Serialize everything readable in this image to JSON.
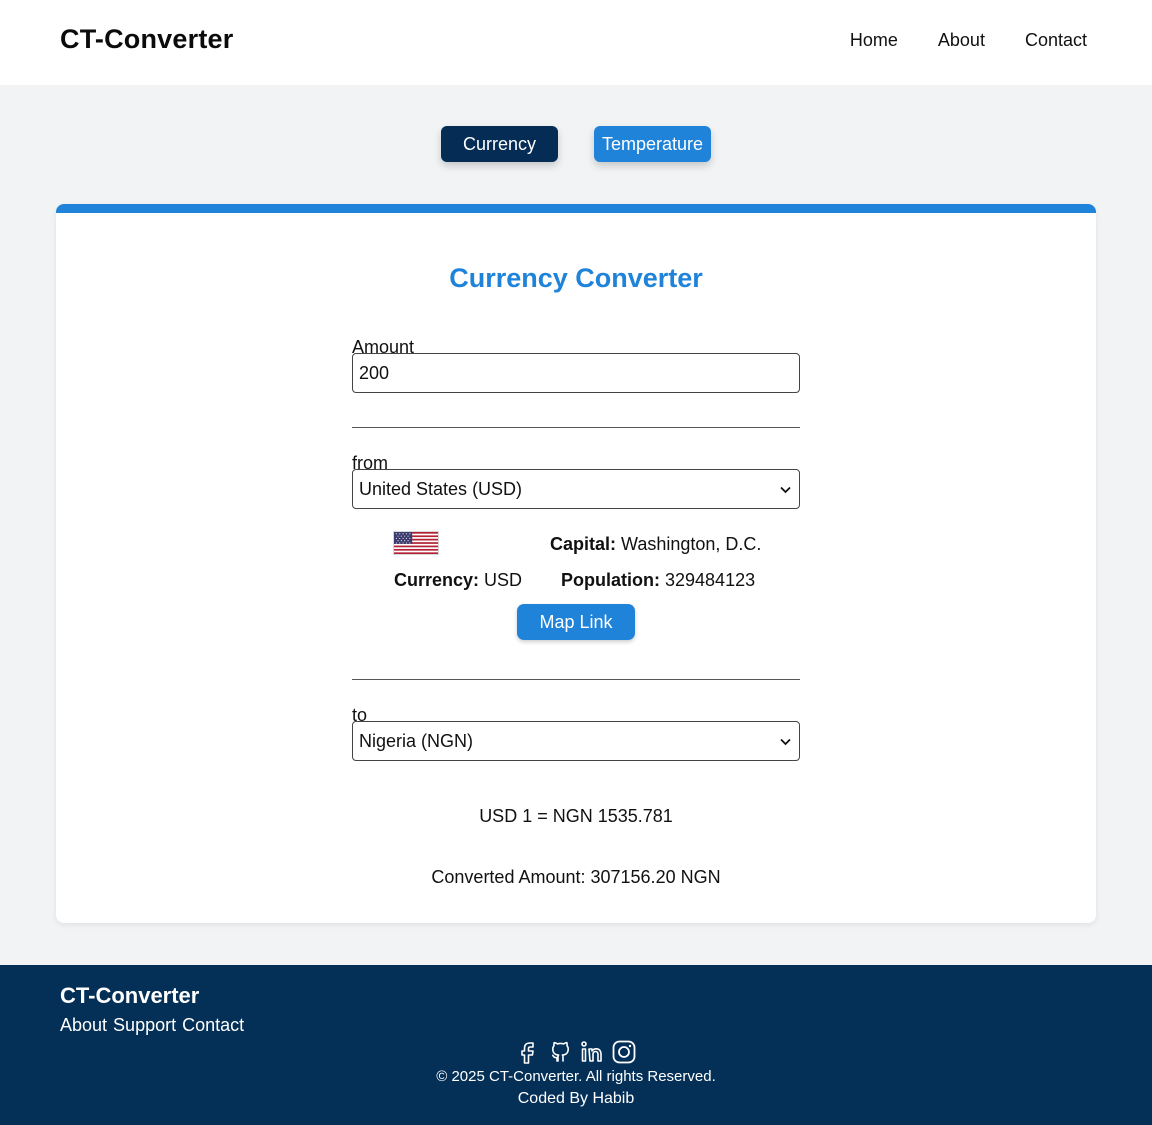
{
  "header": {
    "brand": "CT-Converter",
    "nav": [
      "Home",
      "About",
      "Contact"
    ]
  },
  "tabs": {
    "currency": "Currency",
    "temperature": "Temperature"
  },
  "converter": {
    "title": "Currency Converter",
    "amount_label": "Amount",
    "amount_value": "200",
    "from_label": "from",
    "from_value": "United States (USD)",
    "to_label": "to",
    "to_value": "Nigeria (NGN)",
    "country_info": {
      "capital_label": "Capital:",
      "capital_value": "Washington, D.C.",
      "currency_label": "Currency:",
      "currency_value": "USD",
      "population_label": "Population:",
      "population_value": "329484123",
      "map_link": "Map Link"
    },
    "rate_text": "USD 1 = NGN 1535.781",
    "converted_text": "Converted Amount: 307156.20 NGN"
  },
  "footer": {
    "brand": "CT-Converter",
    "links": [
      "About",
      "Support",
      "Contact"
    ],
    "social_icons": [
      "facebook-icon",
      "github-icon",
      "linkedin-icon",
      "instagram-icon"
    ],
    "copyright": "© 2025 CT-Converter. All rights Reserved.",
    "credit": "Coded By Habib"
  },
  "colors": {
    "primary": "#1f83d9",
    "dark_navy": "#042c54",
    "footer_bg": "#042f56",
    "page_bg": "#f1f3f5"
  }
}
